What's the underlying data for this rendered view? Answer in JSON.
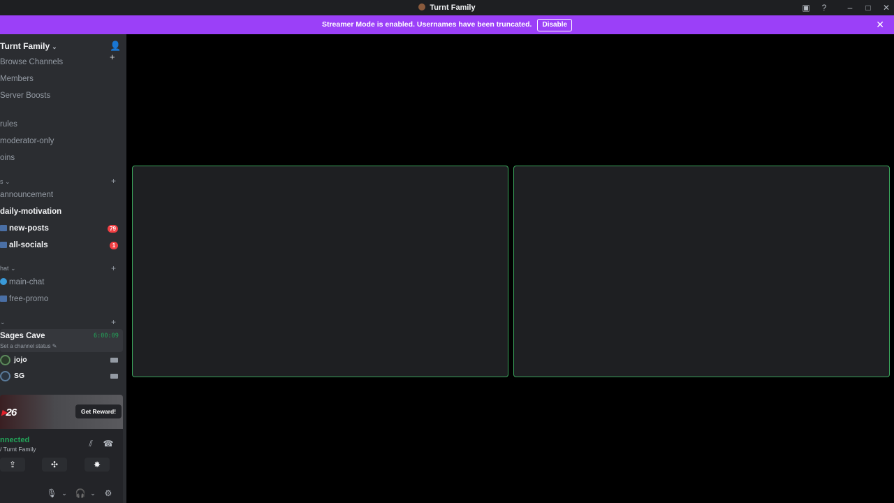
{
  "window": {
    "title": "Turnt Family",
    "controls": {
      "minimize": "–",
      "maximize": "□",
      "close": "✕",
      "inbox": "▣",
      "help": "?"
    }
  },
  "streamer_mode": {
    "message": "Streamer Mode is enabled. Usernames have been truncated.",
    "disable_label": "Disable",
    "close": "✕"
  },
  "server": {
    "name": "Turnt Family",
    "chevron": "⌄",
    "invite_icon": "👤+"
  },
  "nav": [
    {
      "label": "Browse Channels"
    },
    {
      "label": "Members"
    },
    {
      "label": "Server Boosts"
    }
  ],
  "channels_top": [
    {
      "label": "rules"
    },
    {
      "label": "moderator-only"
    },
    {
      "label": "oins"
    }
  ],
  "categories": [
    {
      "label": "s ⌄",
      "plus": "+"
    },
    {
      "label": "hat ⌄",
      "plus": "+"
    },
    {
      "label": "⌄",
      "plus": "+"
    }
  ],
  "channels_cat1": [
    {
      "label": "announcement"
    },
    {
      "label": "daily-motivation"
    },
    {
      "label": "new-posts",
      "badge": "79"
    },
    {
      "label": "all-socials",
      "badge": "1"
    }
  ],
  "channels_cat2": [
    {
      "label": "main-chat"
    },
    {
      "label": "free-promo"
    }
  ],
  "voice": {
    "channel": "Sages Cave",
    "timer": "6:00:09",
    "status": "Set a channel status ✎",
    "users": [
      {
        "name": "jojo"
      },
      {
        "name": "SG"
      }
    ]
  },
  "promo": {
    "logo_prefix": "",
    "logo": "26",
    "reward_label": "Get Reward!"
  },
  "rtc": {
    "status": "nnected",
    "location": "/ Turnt Family",
    "icons": {
      "noise": "⫽",
      "disconnect": "☎",
      "share": "⇪",
      "activities": "✣",
      "soundboard": "✸",
      "mic": "🎙",
      "headset": "🎧",
      "chev": "⌄",
      "settings": "⚙"
    }
  },
  "colors": {
    "streamer_bar": "#9b40f8",
    "tile_border": "#3ba55c",
    "connected_green": "#23a559",
    "badge_red": "#f23f43"
  }
}
